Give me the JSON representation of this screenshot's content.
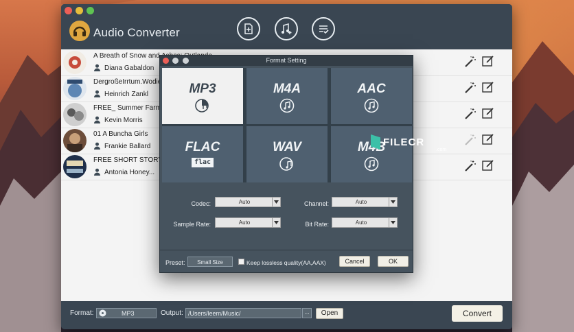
{
  "app": {
    "title": "Audio Converter"
  },
  "tracks": [
    {
      "title": "A Breath of Snow and Ashes: Outlande...",
      "artist": "Diana Gabaldon"
    },
    {
      "title": "DergroßeIrrtum.Wodie...",
      "artist": "Heinrich Zankl"
    },
    {
      "title": "FREE_ Summer Farmer",
      "artist": "Kevin Morris"
    },
    {
      "title": "01 A Buncha Girls",
      "artist": "Frankie Ballard"
    },
    {
      "title": "FREE SHORT STORY_",
      "artist": "Antonia Honey..."
    }
  ],
  "dialog": {
    "title": "Format Setting",
    "formats": [
      {
        "name": "MP3",
        "selected": true
      },
      {
        "name": "M4A",
        "selected": false
      },
      {
        "name": "AAC",
        "selected": false
      },
      {
        "name": "FLAC",
        "selected": false,
        "icon_text": "flac"
      },
      {
        "name": "WAV",
        "selected": false
      },
      {
        "name": "M4B",
        "selected": false
      }
    ],
    "codec_label": "Codec:",
    "codec_value": "Auto",
    "channel_label": "Channel:",
    "channel_value": "Auto",
    "sample_rate_label": "Sample Rate:",
    "sample_rate_value": "Auto",
    "bit_rate_label": "Bit Rate:",
    "bit_rate_value": "Auto",
    "preset_label": "Preset:",
    "preset_value": "Small Size",
    "lossless_label": "Keep lossless quality(AA,AAX)",
    "cancel_label": "Cancel",
    "ok_label": "OK"
  },
  "bottom": {
    "format_label": "Format:",
    "format_value": "MP3",
    "output_label": "Output:",
    "output_path": "/Users/leem/Music/",
    "browse_label": "...",
    "open_label": "Open",
    "convert_label": "Convert"
  },
  "watermark": {
    "text": "FILECR",
    "suffix": ".com"
  },
  "colors": {
    "accent": "#e0a740",
    "window_bg": "#3d4a55",
    "selected_format_bg": "#f1f1f1",
    "format_tile_bg": "#4f6070"
  }
}
